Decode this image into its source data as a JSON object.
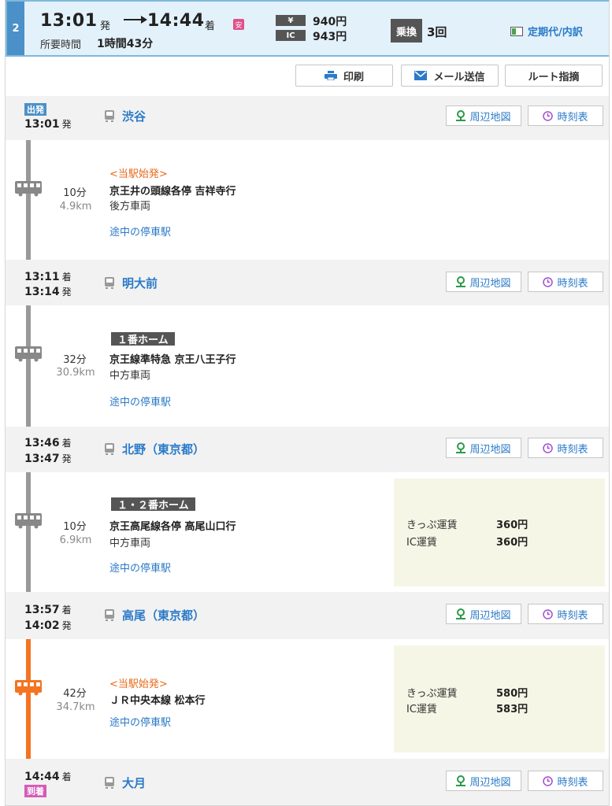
{
  "header": {
    "route_number": "2",
    "depart_time": "13:01",
    "depart_suffix": "発",
    "arrive_time": "14:44",
    "arrive_suffix": "着",
    "safe_badge": "安",
    "duration_label": "所要時間",
    "duration_value": "1時間43分",
    "fare_ticket_tag": "¥",
    "fare_ticket": "940円",
    "fare_ic_tag": "IC",
    "fare_ic": "943円",
    "transfer_label": "乗換",
    "transfer_count": "3回",
    "pass_link": "定期代/内訳"
  },
  "toolbar": {
    "print": "印刷",
    "mail": "メール送信",
    "route_report": "ルート指摘"
  },
  "buttons": {
    "map": "周辺地図",
    "timetable": "時刻表"
  },
  "stations": [
    {
      "tag": "出発",
      "times": [
        {
          "t": "13:01",
          "s": "発"
        }
      ],
      "name": "渋谷"
    },
    {
      "times": [
        {
          "t": "13:11",
          "s": "着"
        },
        {
          "t": "13:14",
          "s": "発"
        }
      ],
      "name": "明大前"
    },
    {
      "times": [
        {
          "t": "13:46",
          "s": "着"
        },
        {
          "t": "13:47",
          "s": "発"
        }
      ],
      "name": "北野（東京都）"
    },
    {
      "times": [
        {
          "t": "13:57",
          "s": "着"
        },
        {
          "t": "14:02",
          "s": "発"
        }
      ],
      "name": "高尾（東京都）"
    },
    {
      "times": [
        {
          "t": "14:44",
          "s": "着"
        }
      ],
      "tag": "到着",
      "name": "大月"
    }
  ],
  "segments": [
    {
      "note": "<当駅始発>",
      "duration": "10分",
      "distance": "4.9km",
      "line": "京王井の頭線各停 吉祥寺行",
      "car": "後方車両",
      "stops": "途中の停車駅"
    },
    {
      "platform": "１番ホーム",
      "duration": "32分",
      "distance": "30.9km",
      "line": "京王線準特急 京王八王子行",
      "car": "中方車両",
      "stops": "途中の停車駅"
    },
    {
      "platform": "１・２番ホーム",
      "duration": "10分",
      "distance": "6.9km",
      "line": "京王高尾線各停 高尾山口行",
      "car": "中方車両",
      "stops": "途中の停車駅",
      "fare": {
        "ticket_label": "きっぷ運賃",
        "ticket": "360円",
        "ic_label": "IC運賃",
        "ic": "360円"
      }
    },
    {
      "note": "<当駅始発>",
      "duration": "42分",
      "distance": "34.7km",
      "line": "ＪＲ中央本線 松本行",
      "stops": "途中の停車駅",
      "fare": {
        "ticket_label": "きっぷ運賃",
        "ticket": "580円",
        "ic_label": "IC運賃",
        "ic": "583円"
      }
    }
  ],
  "colors": {
    "link": "#2a7ac8",
    "header_bg": "#e3f1fb",
    "jr_line": "#f47421",
    "private_line": "#999999",
    "note": "#e86a1c",
    "arrive_tag": "#d55bb7",
    "depart_tag": "#4b90c8"
  }
}
